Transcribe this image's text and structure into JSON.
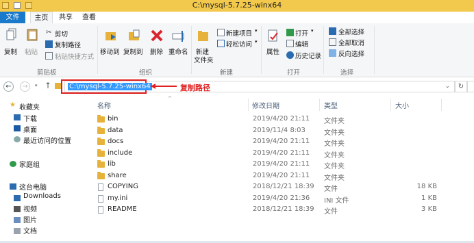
{
  "window": {
    "title": "C:\\mysql-5.7.25-winx64"
  },
  "tabs": [
    "文件",
    "主页",
    "共享",
    "查看"
  ],
  "ribbon": {
    "clipboard": {
      "copy": "复制",
      "paste": "粘贴",
      "cut": "剪切",
      "copy_path": "复制路径",
      "paste_shortcut": "粘贴快捷方式",
      "group": "剪贴板"
    },
    "organize": {
      "move_to": "移动到",
      "copy_to": "复制到",
      "delete": "删除",
      "rename": "重命名",
      "group": "组织"
    },
    "new": {
      "new_folder_line1": "新建",
      "new_folder_line2": "文件夹",
      "new_item": "新建项目",
      "easy_access": "轻松访问",
      "group": "新建"
    },
    "open": {
      "properties": "属性",
      "open": "打开",
      "edit": "编辑",
      "history": "历史记录",
      "group": "打开"
    },
    "select": {
      "select_all": "全部选择",
      "select_none": "全部取消",
      "invert": "反向选择",
      "group": "选择"
    }
  },
  "address": {
    "path": "C:\\mysql-5.7.25-winx64",
    "annotation": "复制路径"
  },
  "nav": {
    "favorites": "收藏夹",
    "downloads": "下载",
    "desktop": "桌面",
    "recent": "最近访问的位置",
    "homegroup": "家庭组",
    "thispc": "这台电脑",
    "pc_downloads": "Downloads",
    "videos": "视频",
    "pictures": "图片",
    "documents": "文档"
  },
  "columns": {
    "name": "名称",
    "date": "修改日期",
    "type": "类型",
    "size": "大小"
  },
  "files": [
    {
      "name": "bin",
      "date": "2019/4/20 21:11",
      "type": "文件夹",
      "size": "",
      "kind": "folder"
    },
    {
      "name": "data",
      "date": "2019/11/4 8:03",
      "type": "文件夹",
      "size": "",
      "kind": "folder"
    },
    {
      "name": "docs",
      "date": "2019/4/20 21:11",
      "type": "文件夹",
      "size": "",
      "kind": "folder"
    },
    {
      "name": "include",
      "date": "2019/4/20 21:11",
      "type": "文件夹",
      "size": "",
      "kind": "folder"
    },
    {
      "name": "lib",
      "date": "2019/4/20 21:11",
      "type": "文件夹",
      "size": "",
      "kind": "folder"
    },
    {
      "name": "share",
      "date": "2019/4/20 21:11",
      "type": "文件夹",
      "size": "",
      "kind": "folder"
    },
    {
      "name": "COPYING",
      "date": "2018/12/21 18:39",
      "type": "文件",
      "size": "18 KB",
      "kind": "file"
    },
    {
      "name": "my.ini",
      "date": "2019/4/20 21:36",
      "type": "INI 文件",
      "size": "1 KB",
      "kind": "file"
    },
    {
      "name": "README",
      "date": "2018/12/21 18:39",
      "type": "文件",
      "size": "3 KB",
      "kind": "file"
    }
  ]
}
